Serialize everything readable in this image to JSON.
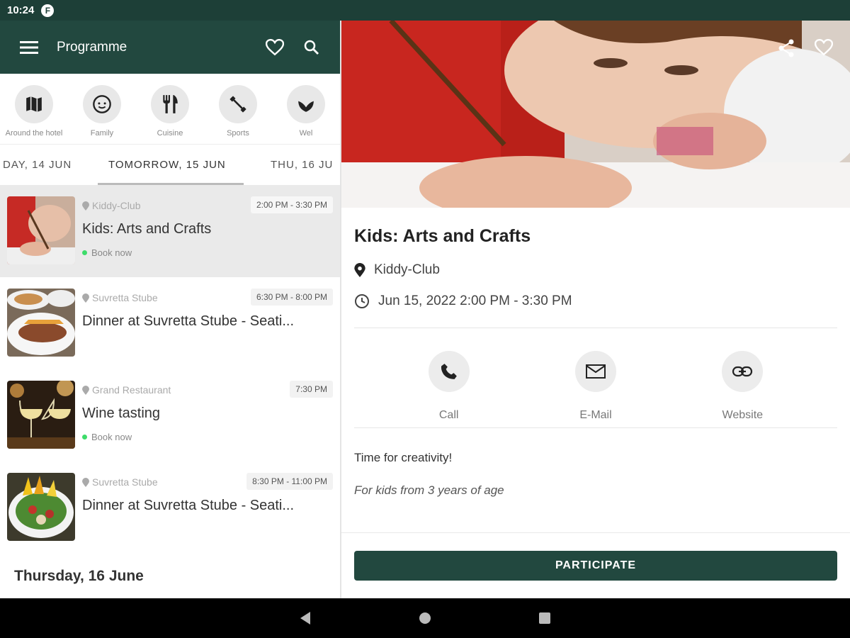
{
  "status": {
    "time": "10:24"
  },
  "appbar": {
    "title": "Programme"
  },
  "categories": [
    {
      "label": "Around the hotel",
      "icon": "map-icon"
    },
    {
      "label": "Family",
      "icon": "face-icon"
    },
    {
      "label": "Cuisine",
      "icon": "cutlery-icon"
    },
    {
      "label": "Sports",
      "icon": "fitness-icon"
    },
    {
      "label": "Wel",
      "icon": "spa-icon"
    }
  ],
  "date_tabs": [
    "DAY, 14 JUN",
    "TOMORROW, 15 JUN",
    "THU, 16 JU"
  ],
  "events": [
    {
      "venue": "Kiddy-Club",
      "time": "2:00 PM - 3:30 PM",
      "name": "Kids: Arts and Crafts",
      "book": "Book now"
    },
    {
      "venue": "Suvretta Stube",
      "time": "6:30 PM - 8:00 PM",
      "name": "Dinner at Suvretta Stube - Seati..."
    },
    {
      "venue": "Grand Restaurant",
      "time": "7:30 PM",
      "name": "Wine tasting",
      "book": "Book now"
    },
    {
      "venue": "Suvretta Stube",
      "time": "8:30 PM - 11:00 PM",
      "name": "Dinner at Suvretta Stube - Seati..."
    }
  ],
  "day_header": "Thursday, 16 June",
  "detail": {
    "title": "Kids: Arts and Crafts",
    "location": "Kiddy-Club",
    "datetime": "Jun 15, 2022 2:00 PM - 3:30 PM",
    "actions": {
      "call": "Call",
      "email": "E-Mail",
      "website": "Website"
    },
    "description": "Time for creativity!",
    "age_note": "For kids from 3 years of age",
    "participate": "PARTICIPATE"
  },
  "colors": {
    "primary": "#22483f",
    "statusbar": "#1d3f37",
    "book_dot": "#3ddc6a"
  }
}
